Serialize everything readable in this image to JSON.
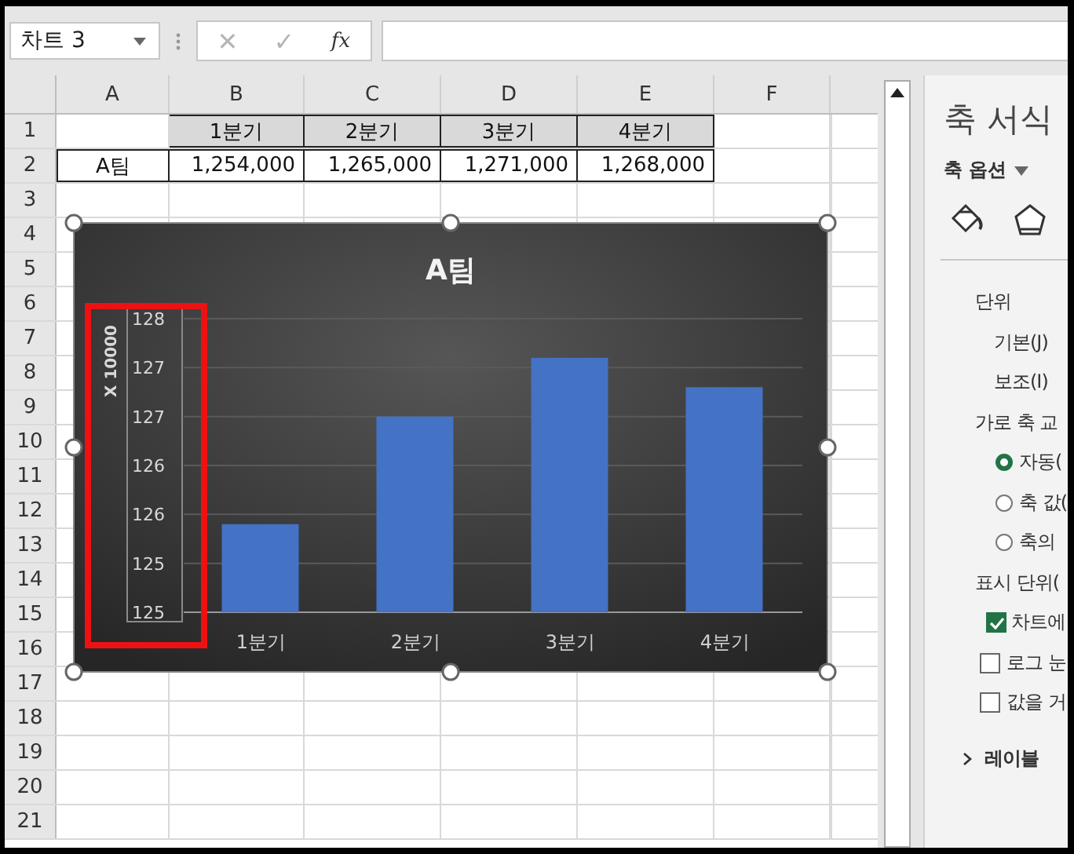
{
  "name_box": {
    "value": "차트 3"
  },
  "formula_bar": {
    "cancel": "✕",
    "enter": "✓",
    "function": "fx",
    "disabled": true
  },
  "columns": [
    "A",
    "B",
    "C",
    "D",
    "E",
    "F"
  ],
  "row_headers": [
    "1",
    "2",
    "3",
    "4",
    "5",
    "6",
    "7",
    "8",
    "9",
    "10",
    "11",
    "12",
    "13",
    "14",
    "15",
    "16",
    "17",
    "18",
    "19",
    "20",
    "21"
  ],
  "data_rows": [
    {
      "kind": "header",
      "cells": [
        "1분기",
        "2분기",
        "3분기",
        "4분기"
      ]
    },
    {
      "kind": "data",
      "label": "A팀",
      "cells": [
        "1,254,000",
        "1,265,000",
        "1,271,000",
        "1,268,000"
      ]
    }
  ],
  "chart": {
    "selected": true,
    "axis_highlighted": true,
    "unit_label": "X 10000",
    "chart_data": {
      "type": "bar",
      "title": "A팀",
      "categories": [
        "1분기",
        "2분기",
        "3분기",
        "4분기"
      ],
      "grid": true,
      "series": [
        {
          "color": "#4472c4",
          "values": [
            125.4,
            126.5,
            127.1,
            126.8
          ]
        }
      ],
      "ylim": [
        124.5,
        127.5
      ],
      "yticks": [
        {
          "value": 124.5,
          "label": "125"
        },
        {
          "value": 125,
          "label": "125"
        },
        {
          "value": 125.5,
          "label": "126"
        },
        {
          "value": 126,
          "label": "126"
        },
        {
          "value": 126.5,
          "label": "127"
        },
        {
          "value": 127,
          "label": "127"
        },
        {
          "value": 127.5,
          "label": "128"
        }
      ]
    }
  },
  "panel": {
    "title": "축 서식",
    "tab": "축 옵션",
    "items": [
      {
        "kind": "heading",
        "text": "단위"
      },
      {
        "kind": "label",
        "text": "기본(J)"
      },
      {
        "kind": "label",
        "text": "보조(I)"
      },
      {
        "kind": "heading",
        "text": "가로 축 교"
      },
      {
        "kind": "radio",
        "text": "자동(",
        "selected": true
      },
      {
        "kind": "radio",
        "text": "축 값(",
        "selected": false
      },
      {
        "kind": "radio",
        "text": "축의",
        "selected": false
      },
      {
        "kind": "heading",
        "text": "표시 단위("
      },
      {
        "kind": "checkbox",
        "text": "차트에",
        "checked": true
      },
      {
        "kind": "checkbox",
        "text": "로그 눈",
        "checked": false
      },
      {
        "kind": "checkbox",
        "text": "값을 거",
        "checked": false
      },
      {
        "kind": "section",
        "text": "레이블",
        "expanded": false
      }
    ]
  }
}
